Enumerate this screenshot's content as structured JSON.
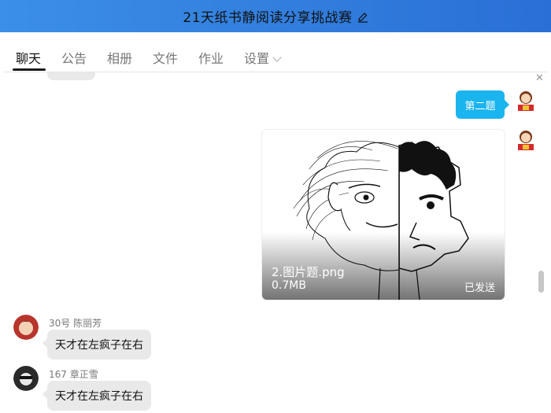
{
  "window": {
    "title": "21天纸书静阅读分享挑战赛"
  },
  "tabs": [
    {
      "label": "聊天",
      "active": true
    },
    {
      "label": "公告"
    },
    {
      "label": "相册"
    },
    {
      "label": "文件"
    },
    {
      "label": "作业"
    },
    {
      "label": "设置"
    }
  ],
  "chat": {
    "outgoing_text": {
      "text": "第二题"
    },
    "outgoing_image": {
      "file_name": "2.图片题.png",
      "file_size": "0.7MB",
      "status": "已发送"
    },
    "messages": [
      {
        "sender": "30号 陈丽芳",
        "text": "天才在左疯子在右"
      },
      {
        "sender": "167 章正雪",
        "text": "天才在左疯子在右"
      }
    ]
  },
  "colors": {
    "titlebar": "#2f7fe0",
    "outgoing_bubble": "#1ab4ef",
    "incoming_bubble": "#e9e9e9"
  }
}
